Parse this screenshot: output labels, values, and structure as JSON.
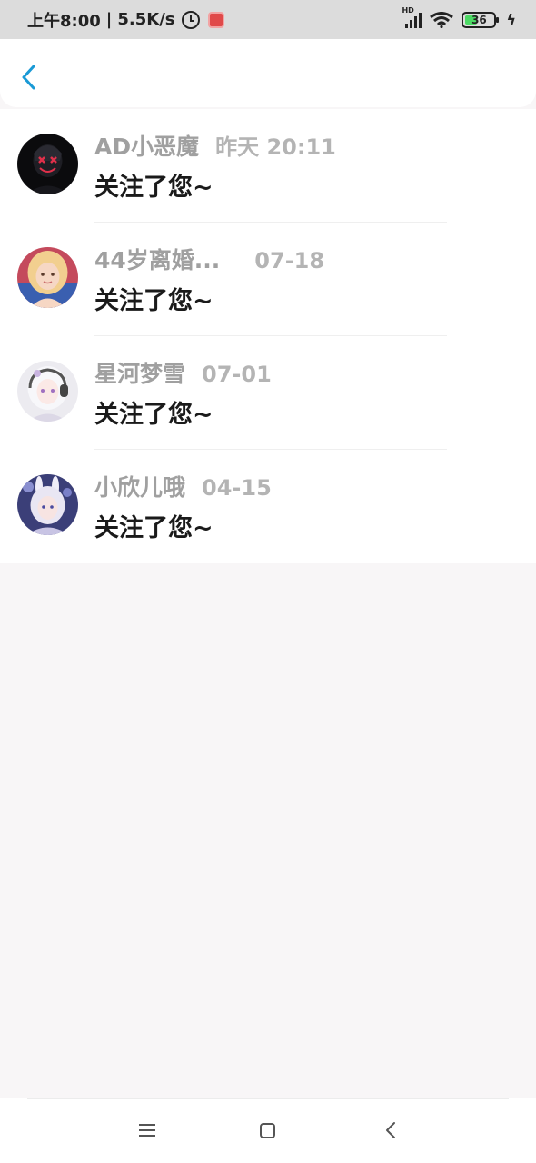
{
  "status_bar": {
    "time": "上午8:00",
    "separator": "|",
    "speed": "5.5K/s",
    "battery": "36",
    "network": "HD"
  },
  "header": {
    "back_icon": "chevron-left-icon",
    "accent_color": "#1a9ad6"
  },
  "notifications": [
    {
      "name": "AD小恶魔",
      "time": "昨天 20:11",
      "message": "关注了您~"
    },
    {
      "name": "44岁离婚...",
      "time": "07-18",
      "message": "关注了您~"
    },
    {
      "name": "星河梦雪",
      "time": "07-01",
      "message": "关注了您~"
    },
    {
      "name": "小欣儿哦",
      "time": "04-15",
      "message": "关注了您~"
    }
  ],
  "system_nav": {
    "menu_icon": "menu-icon",
    "home_icon": "home-icon",
    "back_icon": "back-icon"
  }
}
